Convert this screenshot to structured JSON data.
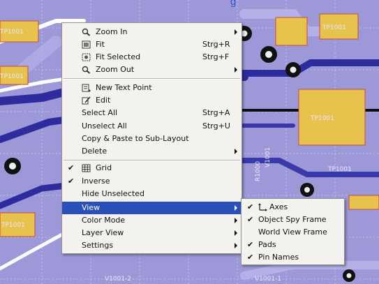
{
  "background": {
    "title_fragment": "g",
    "board_color": "#9c98d8",
    "trace_color": "#2b2a9c",
    "pad_color": "#e8c44e",
    "labels": {
      "tr1": "TP1001",
      "tr2": "TP1001",
      "tr3": "TP1001",
      "tr4": "TP1001",
      "tr5": "TP1001",
      "tr6": "TP1001",
      "vert1": "R1000",
      "vert2": "V1001",
      "bottom1": "V1001-2",
      "bottom2": "V1001-1"
    }
  },
  "context_menu": {
    "zoom_in": {
      "label": "Zoom In",
      "icon": "zoom-in-icon"
    },
    "fit": {
      "label": "Fit",
      "shortcut": "Strg+R",
      "icon": "fit-icon"
    },
    "fit_selected": {
      "label": "Fit Selected",
      "shortcut": "Strg+F",
      "icon": "fit-selected-icon"
    },
    "zoom_out": {
      "label": "Zoom Out",
      "icon": "zoom-out-icon"
    },
    "new_text_point": {
      "label": "New Text Point",
      "icon": "new-text-point-icon"
    },
    "edit": {
      "label": "Edit",
      "icon": "edit-icon"
    },
    "select_all": {
      "label": "Select All",
      "shortcut": "Strg+A"
    },
    "unselect_all": {
      "label": "Unselect All",
      "shortcut": "Strg+U"
    },
    "copy_paste": {
      "label": "Copy & Paste to Sub-Layout"
    },
    "delete": {
      "label": "Delete"
    },
    "grid": {
      "label": "Grid",
      "checked": true,
      "icon": "grid-icon"
    },
    "inverse": {
      "label": "Inverse",
      "checked": true
    },
    "hide_unselected": {
      "label": "Hide Unselected"
    },
    "view": {
      "label": "View",
      "highlighted": true
    },
    "color_mode": {
      "label": "Color Mode"
    },
    "layer_view": {
      "label": "Layer View"
    },
    "settings": {
      "label": "Settings"
    }
  },
  "view_submenu": {
    "axes": {
      "label": "Axes",
      "checked": true,
      "icon": "axes-icon"
    },
    "object_spy_frame": {
      "label": "Object Spy Frame",
      "checked": true
    },
    "world_view_frame": {
      "label": "World View Frame",
      "checked": false
    },
    "pads": {
      "label": "Pads",
      "checked": true
    },
    "pin_names": {
      "label": "Pin Names",
      "checked": true
    }
  },
  "colors": {
    "menu_bg": "#f3f2ee",
    "highlight": "#2a4fb8"
  }
}
